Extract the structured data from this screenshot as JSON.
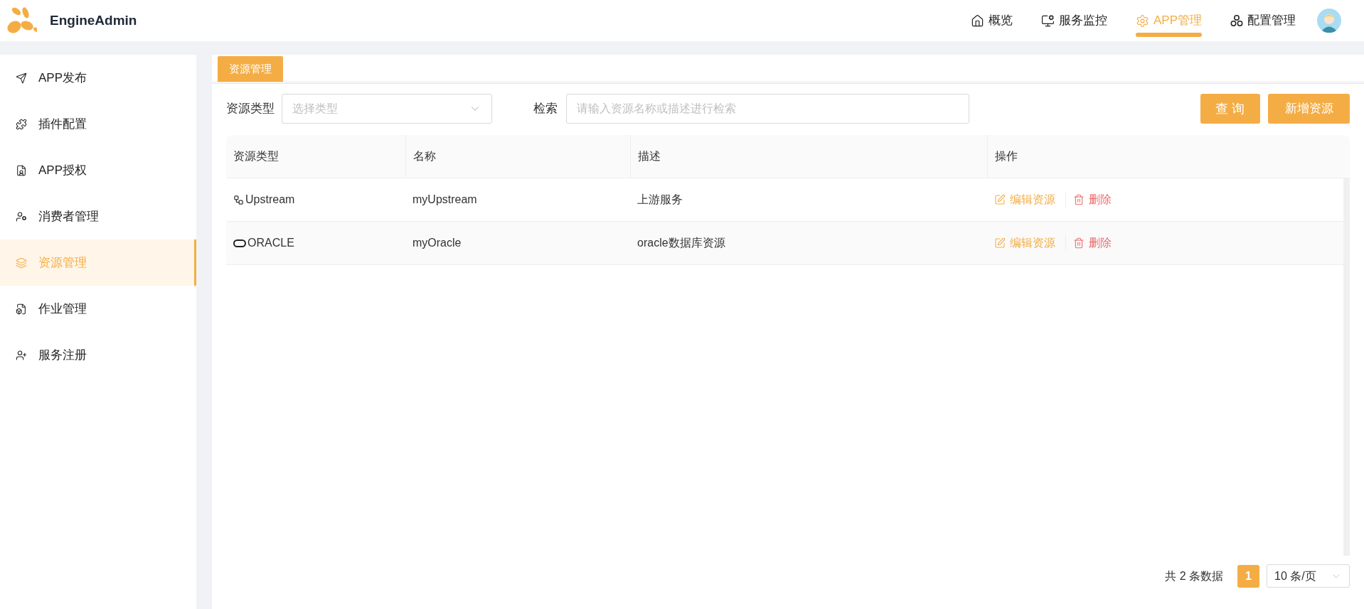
{
  "brand": {
    "name": "EngineAdmin"
  },
  "top_nav": [
    {
      "label": "概览",
      "selected": false
    },
    {
      "label": "服务监控",
      "selected": false
    },
    {
      "label": "APP管理",
      "selected": true
    },
    {
      "label": "配置管理",
      "selected": false
    }
  ],
  "sidebar": {
    "items": [
      {
        "label": "APP发布",
        "selected": false
      },
      {
        "label": "插件配置",
        "selected": false
      },
      {
        "label": "APP授权",
        "selected": false
      },
      {
        "label": "消费者管理",
        "selected": false
      },
      {
        "label": "资源管理",
        "selected": true
      },
      {
        "label": "作业管理",
        "selected": false
      },
      {
        "label": "服务注册",
        "selected": false
      }
    ]
  },
  "tabs": [
    {
      "label": "资源管理",
      "selected": true
    }
  ],
  "filters": {
    "type_label": "资源类型",
    "type_placeholder": "选择类型",
    "search_label": "检索",
    "search_placeholder": "请输入资源名称或描述进行检索"
  },
  "buttons": {
    "query": "查 询",
    "add": "新增资源"
  },
  "table": {
    "columns": [
      "资源类型",
      "名称",
      "描述",
      "操作"
    ],
    "rows": [
      {
        "type": "Upstream",
        "kind": "upstream",
        "name": "myUpstream",
        "description": "上游服务",
        "edit": "编辑资源",
        "delete": "删除"
      },
      {
        "type": "ORACLE",
        "kind": "oracle",
        "name": "myOracle",
        "description": "oracle数据库资源",
        "edit": "编辑资源",
        "delete": "删除"
      }
    ]
  },
  "pagination": {
    "total": "共 2 条数据",
    "pages": [
      {
        "label": "1",
        "selected": true
      }
    ],
    "page_size": "10 条/页"
  }
}
